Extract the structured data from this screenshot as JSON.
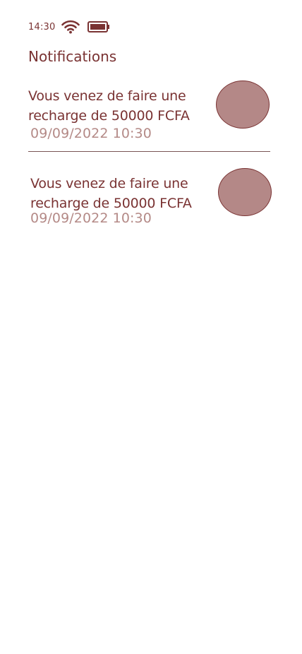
{
  "status_bar": {
    "time": "14:30",
    "wifi_icon": "wifi-icon",
    "battery_icon": "battery-icon"
  },
  "page": {
    "title": "Notifications"
  },
  "notifications": [
    {
      "message": "Vous venez de faire une recharge de 50000 FCFA",
      "date": "09/09/2022 10:30"
    },
    {
      "message": "Vous venez de faire une recharge de 50000 FCFA",
      "date": "09/09/2022 10:30"
    }
  ],
  "colors": {
    "primary": "#7a3333",
    "muted": "#b48a87",
    "avatar": "#b48887",
    "background": "#ffffff"
  }
}
